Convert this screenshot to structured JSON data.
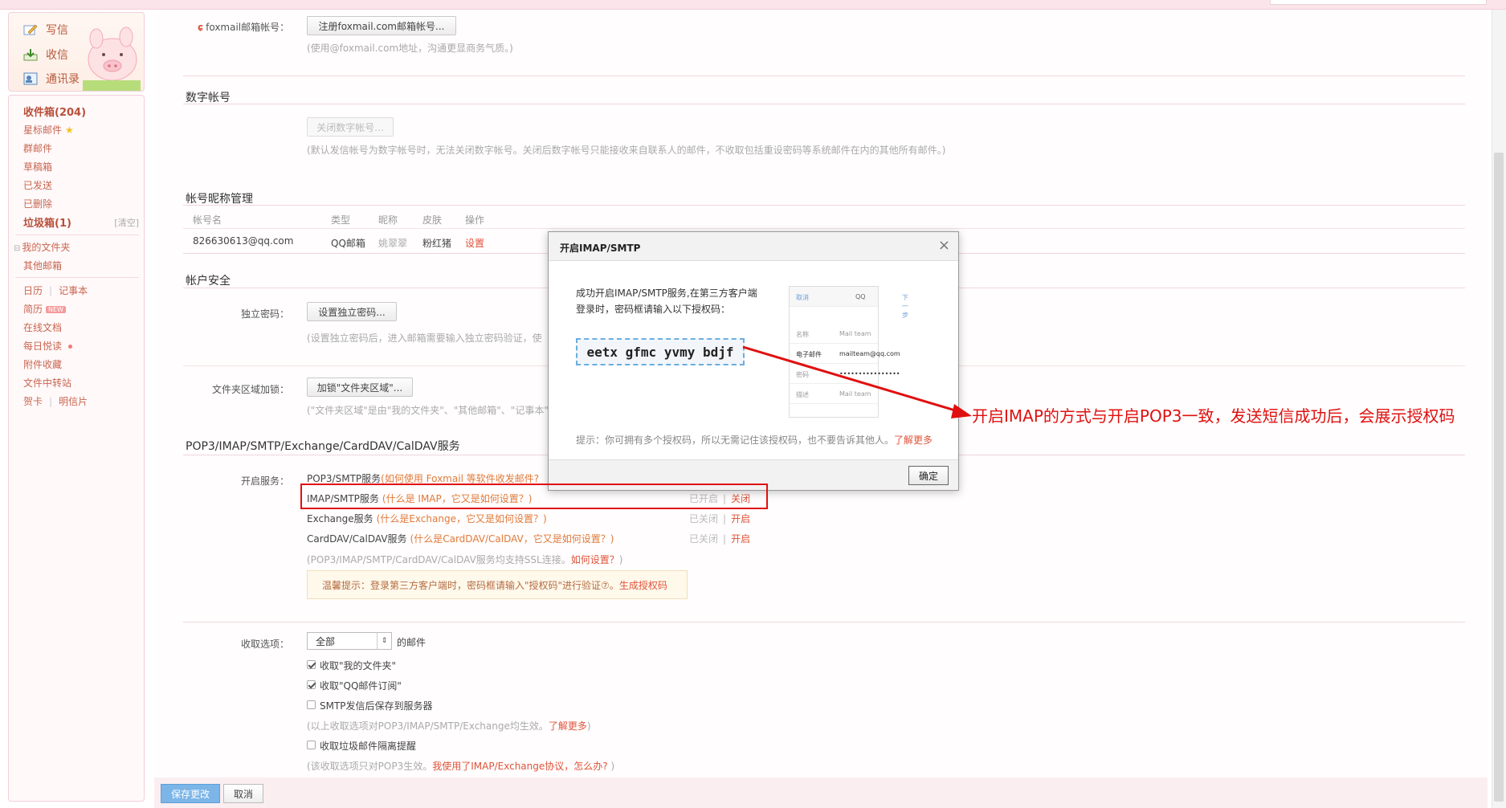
{
  "quick": {
    "compose": "写信",
    "inbox": "收信",
    "contacts": "通讯录"
  },
  "nav": {
    "inbox": "收件箱(204)",
    "starred": "星标邮件",
    "group": "群邮件",
    "drafts": "草稿箱",
    "sent": "已发送",
    "deleted": "已删除",
    "spam": "垃圾箱(1)",
    "clear": "[清空]",
    "my_folders": "我的文件夹",
    "other_mailbox": "其他邮箱",
    "calendar": "日历",
    "notes": "记事本",
    "resume": "简历",
    "new_badge": "NEW",
    "docs": "在线文档",
    "daily": "每日悦读",
    "attach_fav": "附件收藏",
    "transfer": "文件中转站",
    "card": "贺卡",
    "postcard": "明信片",
    "sep": "|"
  },
  "foxmail": {
    "label": "foxmail邮箱帐号：",
    "button": "注册foxmail.com邮箱帐号...",
    "hint": "(使用@foxmail.com地址，沟通更显商务气质。)"
  },
  "digital": {
    "title": "数字帐号",
    "button": "关闭数字帐号...",
    "hint": "(默认发信帐号为数字帐号时，无法关闭数字帐号。关闭后数字帐号只能接收来自联系人的邮件，不收取包括重设密码等系统邮件在内的其他所有邮件。)"
  },
  "nickname": {
    "title": "帐号昵称管理",
    "headers": [
      "帐号名",
      "类型",
      "昵称",
      "皮肤",
      "操作"
    ],
    "row": {
      "account": "826630613@qq.com",
      "type": "QQ邮箱",
      "nick": "姚翠翠",
      "skin": "粉红猪",
      "action": "设置"
    }
  },
  "security": {
    "title": "帐户安全",
    "pwd_label": "独立密码：",
    "pwd_button": "设置独立密码...",
    "pwd_hint": "(设置独立密码后，进入邮箱需要输入独立密码验证，使",
    "folder_label": "文件夹区域加锁：",
    "folder_button": "加锁\"文件夹区域\"...",
    "folder_hint": "(\"文件夹区域\"是由\"我的文件夹\"、\"其他邮箱\"、\"记事本\""
  },
  "services": {
    "title": "POP3/IMAP/SMTP/Exchange/CardDAV/CalDAV服务",
    "label": "开启服务：",
    "pop3": {
      "name": "POP3/SMTP服务",
      "help": "(如何使用 Foxmail 等软件收发邮件?"
    },
    "imap": {
      "name": "IMAP/SMTP服务",
      "help": "(什么是 IMAP，它又是如何设置？)",
      "status": "已开启",
      "action": "关闭"
    },
    "exchange": {
      "name": "Exchange服务",
      "help": "(什么是Exchange，它又是如何设置？)",
      "status": "已关闭",
      "action": "开启"
    },
    "caldav": {
      "name": "CardDAV/CalDAV服务",
      "help": "(什么是CardDAV/CalDAV，它又是如何设置？)",
      "status": "已关闭",
      "action": "开启"
    },
    "sep": "|",
    "ssl_prefix": "(POP3/IMAP/SMTP/CardDAV/CalDAV服务均支持SSL连接。",
    "ssl_link": "如何设置？",
    "ssl_suffix": ")",
    "tip_prefix": "温馨提示：登录第三方客户端时，密码框请输入\"授权码\"进行验证",
    "tip_q": "⑦。",
    "tip_link": "生成授权码"
  },
  "receive": {
    "label": "收取选项：",
    "select_value": "全部",
    "select_arrow": "⇕",
    "suffix": "的邮件",
    "opt1": "收取\"我的文件夹\"",
    "opt2": "收取\"QQ邮件订阅\"",
    "opt3": "SMTP发信后保存到服务器",
    "note_prefix": "(以上收取选项对POP3/IMAP/SMTP/Exchange均生效。",
    "note_link": "了解更多",
    "note_suffix": ")",
    "opt4": "收取垃圾邮件隔离提醒",
    "note2_prefix": "(该收取选项只对POP3生效。",
    "note2_link": "我使用了IMAP/Exchange协议，怎么办?",
    "note2_suffix": " )"
  },
  "footer": {
    "save": "保存更改",
    "cancel": "取消"
  },
  "dialog": {
    "title": "开启IMAP/SMTP",
    "close": "×",
    "text": "成功开启IMAP/SMTP服务,在第三方客户端登录时，密码框请输入以下授权码：",
    "code": "eetx gfmc yvmy bdjf",
    "phone": {
      "cancel": "取消",
      "center": "QQ",
      "next": "下一步",
      "rows": [
        {
          "k": "名称",
          "v": "Mail team"
        },
        {
          "k": "电子邮件",
          "v": "mailteam@qq.com"
        },
        {
          "k": "密码",
          "v": "••••••••••••••••"
        },
        {
          "k": "描述",
          "v": "Mail team"
        }
      ]
    },
    "tip": "提示：你可拥有多个授权码，所以无需记住该授权码，也不要告诉其他人。",
    "tip_link": "了解更多",
    "ok": "确定"
  },
  "annotation": "开启IMAP的方式与开启POP3一致，发送短信成功后，会展示授权码",
  "colors": {
    "accent_red": "#e01010",
    "link": "#e0533a",
    "pink_border": "#f2cfd8"
  }
}
